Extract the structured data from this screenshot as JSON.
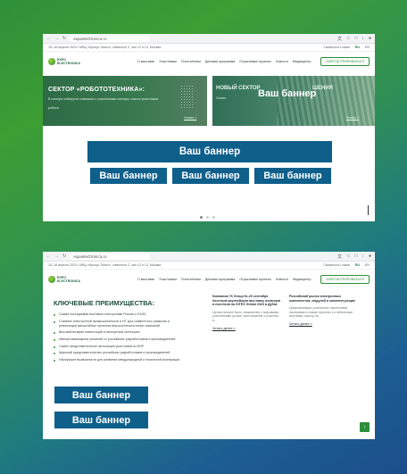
{
  "colors": {
    "banner_bg": "#0f5f8b",
    "brand_green": "#2c8f3a"
  },
  "browser": {
    "url": "expoelectronica.ru",
    "nav_icons": [
      "arrow-left-icon",
      "arrow-right-icon",
      "reload-icon"
    ],
    "toolbar_icons": [
      "translate-icon",
      "star-icon",
      "tab-icon",
      "download-icon",
      "profile-icon"
    ]
  },
  "infobar": {
    "dates": "15–18 апреля 2024 • МВЦ «Крокус Экспо», павильон 2, зал 12 и 13, Москва",
    "contact_link": "Связаться с нами",
    "lang_en": "EN",
    "lang_ru": "RU"
  },
  "site": {
    "logo_line1": "EXPO",
    "logo_line2": "ELECTRONICA",
    "nav": [
      "О выставке",
      "Участникам",
      "Посетителям",
      "Деловая программа",
      "Отраслевые проекты",
      "Новости",
      "Медиацентр"
    ],
    "register_button": "ЗАРЕГИСТРИРОВАТЬСЯ"
  },
  "shot1": {
    "hero_left": {
      "title": "СЕКТОР «РОБОТОТЕХНИКА»:",
      "text": "В секторе соберутся компании с участниками сектора, список участников",
      "text2": "роботы",
      "link": "Узнать >"
    },
    "hero_right": {
      "title": "НОВЫЙ СЕКТОР",
      "title_tail": "ШЕНИЯ",
      "text": "Узнать",
      "link": "Узнать >"
    },
    "banner_overlay": "Ваш баннер",
    "banner_big": "Ваш баннер",
    "banners_small": [
      "Ваш баннер",
      "Ваш баннер",
      "Ваш баннер"
    ]
  },
  "shot2": {
    "advantages_title": "КЛЮЧЕВЫЕ ПРЕИМУЩЕСТВА:",
    "advantages": [
      "Самая посещаемая выставка электроники России и ЕАЭС",
      "Слияние электронной промышленности и ИТ для совместного развития и реализации масштабных проектов высокотехнологичных компаний",
      "Высокий возврат инвестиций и экспортный потенциал",
      "Импортозамещение решений от российских разработчиков и производителей",
      "Самое представительное экспозиция участников из КНР",
      "Широкий представительство российских разработчиков и производителей",
      "Наилучшие возможности для развития международной и локальной кооперации"
    ],
    "news": [
      {
        "title": "Компания ГК Group №-20 сентября посетила крупнейшую выставку испанцев и посетила на GITEX Global 2023 в Дубае",
        "text": "Целью визита было знакомство с мировыми участниками рынка, приглашение к участию в...",
        "more": "Читать далее >"
      },
      {
        "title": "Российский рынок электронных компонентов, модулей и комплектующих",
        "text": "Цифровизация участниках отраслевая экономика и новые проекты к стабильным выставку спросу на...",
        "more": "Читать далее >"
      }
    ],
    "banners": [
      "Ваш баннер",
      "Ваш баннер"
    ]
  }
}
